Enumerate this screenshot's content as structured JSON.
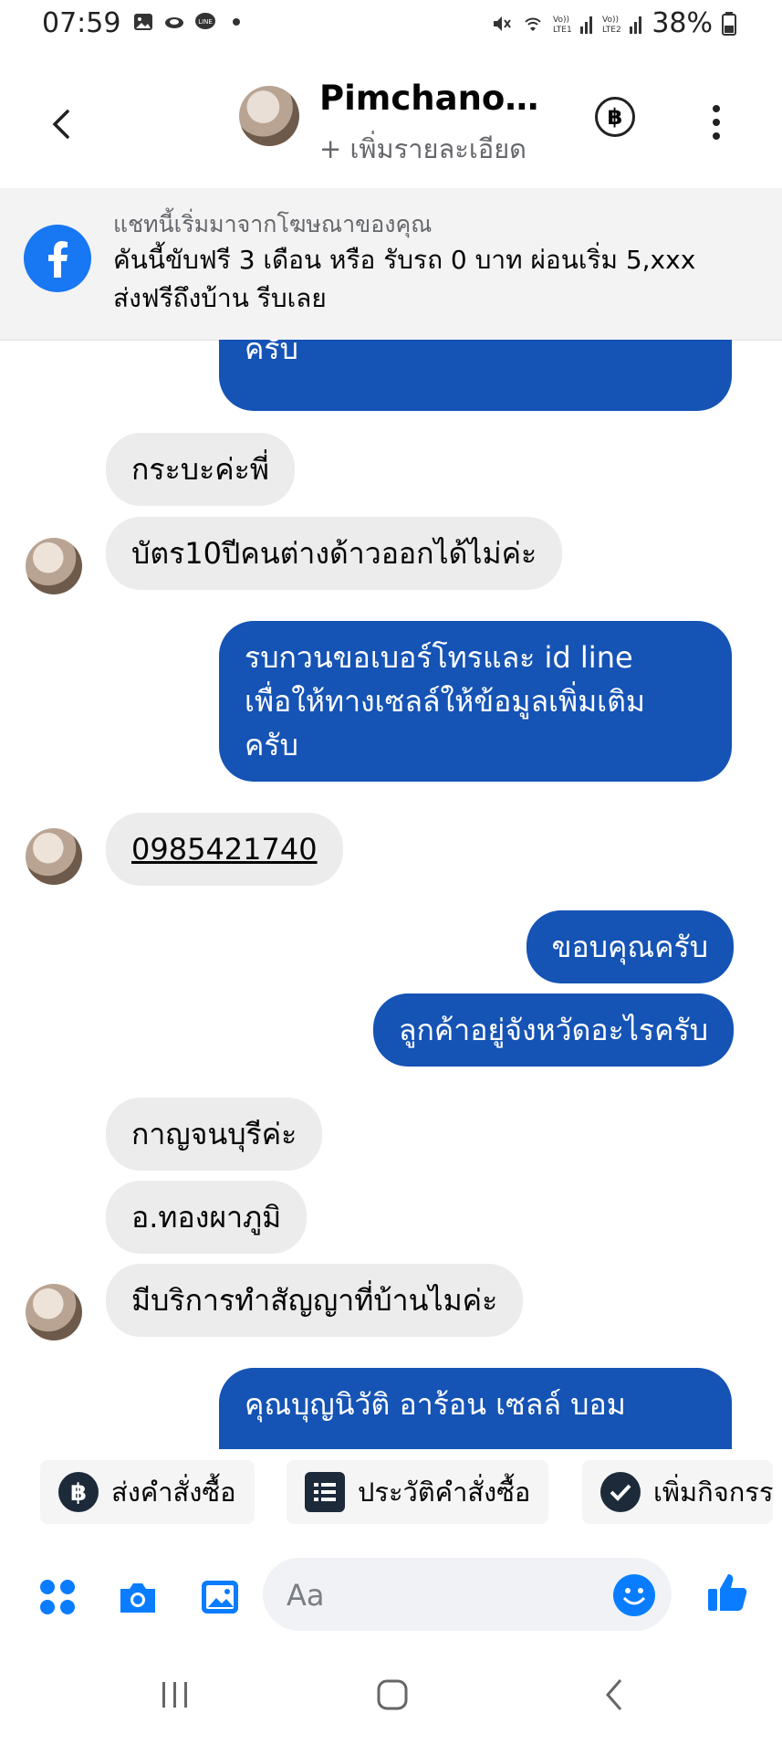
{
  "status_bar": {
    "time": "07:59",
    "battery": "38%",
    "left_icons": [
      "gallery-icon",
      "cloud-icon",
      "line-icon",
      "dot-icon"
    ],
    "right_icons": [
      "mute-icon",
      "wifi-icon",
      "signal-lte1-icon",
      "signal-lte2-icon",
      "battery-icon"
    ]
  },
  "header": {
    "name": "Pimchanok...",
    "subtitle": "+ เพิ่มรายละเอียด",
    "baht_symbol": "฿"
  },
  "ad_banner": {
    "meta": "แชทนี้เริ่มมาจากโฆษณาของคุณ",
    "line1": "คันนี้ขับฟรี 3 เดือน หรือ รับรถ 0 บาท ผ่อนเริ่ม 5,xxx",
    "line2": "ส่งฟรีถึงบ้าน รีบเลย"
  },
  "messages": {
    "m0": "ครับ",
    "m1": "กระบะค่ะพี่",
    "m2": "บัตร10ปีคนต่างด้าวออกได้ไม่ค่ะ",
    "m3a": "รบกวนขอเบอร์โทรและ id line",
    "m3b": "เพื่อให้ทางเซลล์ให้ข้อมูลเพิ่มเติม",
    "m3c": "ครับ",
    "m4": "0985421740",
    "m5": "ขอบคุณครับ",
    "m6": "ลูกค้าอยู่จังหวัดอะไรครับ",
    "m7": "กาญจนบุรีค่ะ",
    "m8": "อ.ทองผาภูมิ",
    "m9": "มีบริการทำสัญญาที่บ้านไมค่ะ",
    "m10": "คุณบุญนิวัติ อาร้อน เซลล์ บอม"
  },
  "quick_actions": {
    "send_order": "ส่งคำสั่งซื้อ",
    "order_history": "ประวัติคำสั่งซื้อ",
    "add_activity": "เพิ่มกิจกรร"
  },
  "composer": {
    "placeholder": "Aa"
  },
  "colors": {
    "outgoing_bubble": "#1553b5",
    "incoming_bubble": "#ececec",
    "accent": "#1877f2"
  }
}
